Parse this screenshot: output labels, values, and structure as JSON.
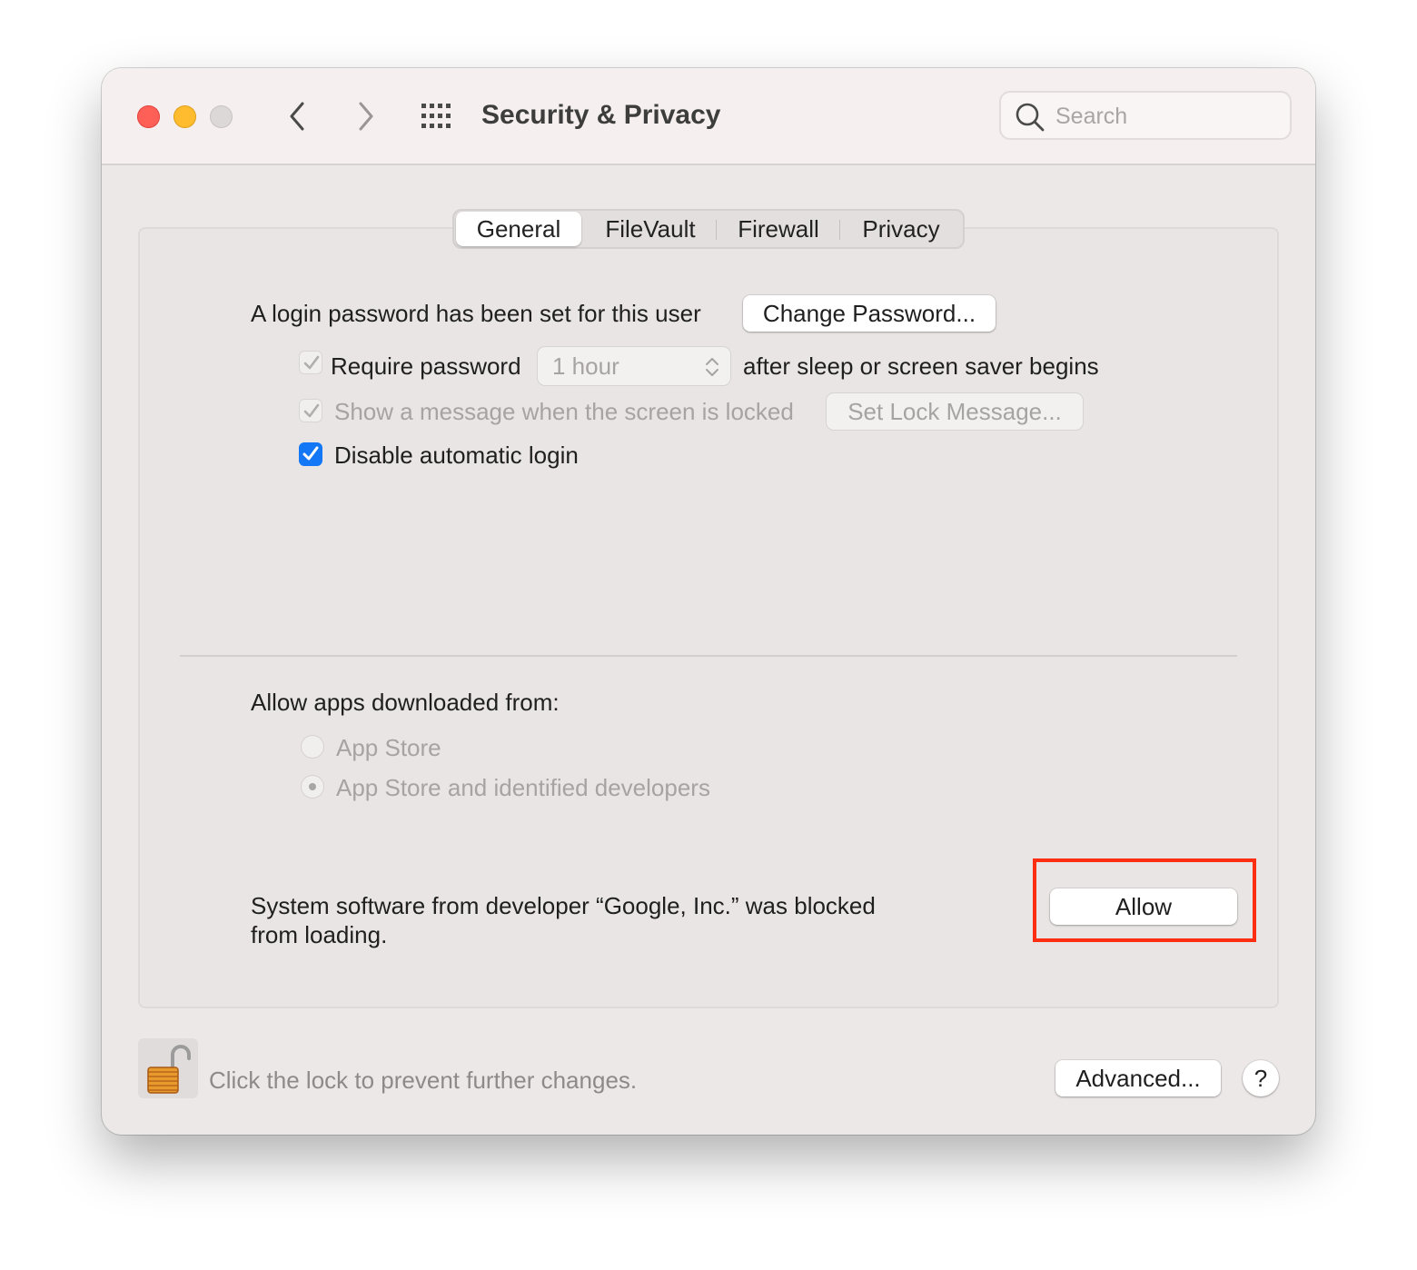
{
  "window": {
    "title": "Security & Privacy",
    "search_placeholder": "Search"
  },
  "tabs": [
    {
      "label": "General",
      "selected": true
    },
    {
      "label": "FileVault",
      "selected": false
    },
    {
      "label": "Firewall",
      "selected": false
    },
    {
      "label": "Privacy",
      "selected": false
    }
  ],
  "general": {
    "login_password_text": "A login password has been set for this user",
    "change_password_label": "Change Password...",
    "require_password": {
      "label": "Require password",
      "checked": true,
      "enabled": false
    },
    "require_password_delay": "1 hour",
    "require_password_suffix": "after sleep or screen saver begins",
    "show_message": {
      "label": "Show a message when the screen is locked",
      "checked": true,
      "enabled": false
    },
    "set_lock_message_label": "Set Lock Message...",
    "disable_auto_login": {
      "label": "Disable automatic login",
      "checked": true,
      "enabled": true
    },
    "allow_apps_heading": "Allow apps downloaded from:",
    "allow_apps_options": [
      {
        "label": "App Store",
        "selected": false
      },
      {
        "label": "App Store and identified developers",
        "selected": true
      }
    ],
    "blocked_message_line1": "System software from developer “Google, Inc.” was blocked",
    "blocked_message_line2": "from loading.",
    "allow_button_label": "Allow"
  },
  "footer": {
    "lock_text": "Click the lock to prevent further changes.",
    "advanced_label": "Advanced...",
    "help_label": "?"
  },
  "colors": {
    "accent": "#1477f6",
    "highlight": "#ff2d12",
    "close": "#fe5f57",
    "minimize": "#febc2e"
  }
}
